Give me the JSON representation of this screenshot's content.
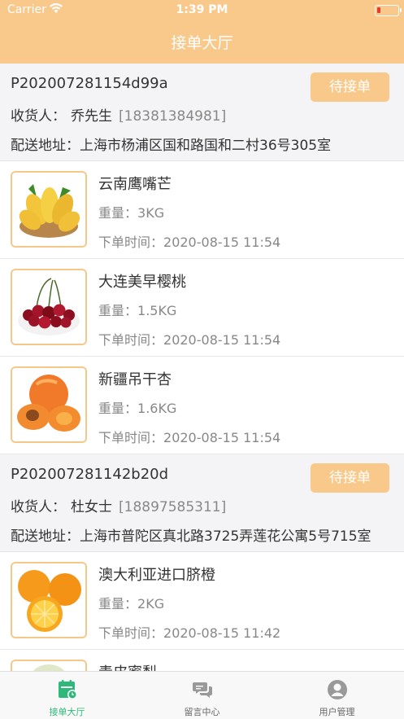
{
  "status_bar": {
    "carrier": "Carrier",
    "time": "1:39 PM"
  },
  "title": "接单大厅",
  "orders": [
    {
      "id": "P202007281154d99a",
      "status": "待接单",
      "receiver_label": "收货人：",
      "receiver_name": "乔先生",
      "receiver_phone": "[18381384981]",
      "address_label": "配送地址：",
      "address": "上海市杨浦区国和路国和二村36号305室",
      "items": [
        {
          "name": "云南鹰嘴芒",
          "weight_label": "重量：",
          "weight": "3KG",
          "time_label": "下单时间：",
          "time": "2020-08-15 11:54",
          "icon": "mango-image"
        },
        {
          "name": "大连美早樱桃",
          "weight_label": "重量：",
          "weight": "1.5KG",
          "time_label": "下单时间：",
          "time": "2020-08-15 11:54",
          "icon": "cherry-image"
        },
        {
          "name": "新疆吊干杏",
          "weight_label": "重量：",
          "weight": "1.6KG",
          "time_label": "下单时间：",
          "time": "2020-08-15 11:54",
          "icon": "apricot-image"
        }
      ]
    },
    {
      "id": "P202007281142b20d",
      "status": "待接单",
      "receiver_label": "收货人：",
      "receiver_name": "杜女士",
      "receiver_phone": "[18897585311]",
      "address_label": "配送地址：",
      "address": "上海市普陀区真北路3725弄莲花公寓5号715室",
      "items": [
        {
          "name": "澳大利亚进口脐橙",
          "weight_label": "重量：",
          "weight": "2KG",
          "time_label": "下单时间：",
          "time": "2020-08-15 11:42",
          "icon": "orange-image"
        },
        {
          "name": "青皮蜜梨",
          "icon": "pear-image"
        }
      ]
    }
  ],
  "tabs": [
    {
      "label": "接单大厅",
      "icon": "order-hall-icon",
      "active": true
    },
    {
      "label": "留言中心",
      "icon": "message-icon",
      "active": false
    },
    {
      "label": "用户管理",
      "icon": "user-icon",
      "active": false
    }
  ],
  "colors": {
    "accent": "#f8c98a",
    "tab_active": "#2eb87a",
    "battery_low": "#e8382f"
  }
}
